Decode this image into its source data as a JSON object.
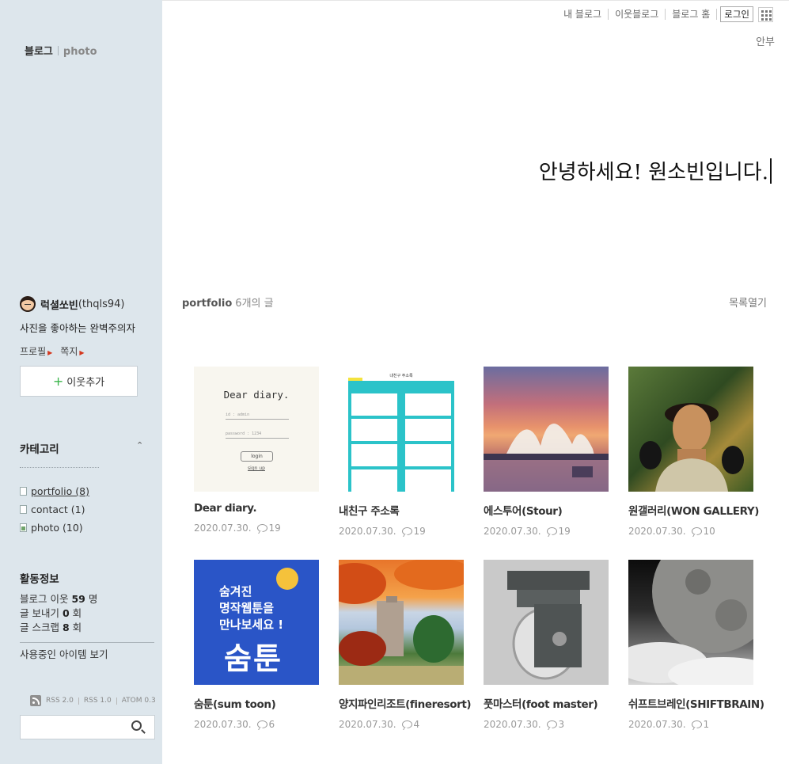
{
  "header": {
    "nav": [
      "내 블로그",
      "이웃블로그",
      "블로그 홈"
    ],
    "login": "로그인",
    "sub_nav": "안부"
  },
  "sidebar": {
    "brand": "블로그",
    "brand_category": "photo",
    "profile": {
      "nickname": "럭셜쏘빈",
      "user_id": "(thqls94)",
      "description": "사진을 좋아하는 완벽주의자",
      "links": [
        "프로필",
        "쪽지"
      ],
      "add_neighbor": "이웃추가"
    },
    "category": {
      "title": "카테고리",
      "items": [
        {
          "label": "portfolio (8)",
          "icon": "doc-icon",
          "active": true
        },
        {
          "label": "contact (1)",
          "icon": "doc-icon",
          "active": false
        },
        {
          "label": "photo (10)",
          "icon": "image-icon",
          "active": false
        }
      ]
    },
    "activity": {
      "title": "활동정보",
      "rows": [
        {
          "pre": "블로그 이웃 ",
          "num": "59",
          "post": " 명"
        },
        {
          "pre": "글 보내기 ",
          "num": "0",
          "post": " 회"
        },
        {
          "pre": "글 스크랩 ",
          "num": "8",
          "post": " 회"
        }
      ],
      "items_link": "사용중인 아이템 보기"
    },
    "feeds": [
      "RSS 2.0",
      "RSS 1.0",
      "ATOM 0.3"
    ],
    "search": {
      "placeholder": ""
    }
  },
  "main": {
    "greeting": "안녕하세요! 원소빈입니다.",
    "list_category": "portfolio",
    "list_count": "6개의 글",
    "list_open": "목록열기",
    "posts": [
      {
        "title": "Dear diary.",
        "date": "2020.07.30.",
        "comments": "19",
        "thumb": "t-diary"
      },
      {
        "title": "내친구 주소록",
        "date": "2020.07.30.",
        "comments": "19",
        "thumb": "t-addr"
      },
      {
        "title": "에스투어(Stour)",
        "date": "2020.07.30.",
        "comments": "19",
        "thumb": "t-opera"
      },
      {
        "title": "원갤러리(WON GALLERY)",
        "date": "2020.07.30.",
        "comments": "10",
        "thumb": "t-frida"
      },
      {
        "title": "숨툰(sum toon)",
        "date": "2020.07.30.",
        "comments": "6",
        "thumb": "t-sum"
      },
      {
        "title": "양지파인리조트(fineresort)",
        "date": "2020.07.30.",
        "comments": "4",
        "thumb": "t-resort"
      },
      {
        "title": "풋마스터(foot master)",
        "date": "2020.07.30.",
        "comments": "3",
        "thumb": "t-caster"
      },
      {
        "title": "쉬프트브레인(SHIFTBRAIN)",
        "date": "2020.07.30.",
        "comments": "1",
        "thumb": "t-moon"
      }
    ],
    "thumb_text": {
      "diary": {
        "heading": "Dear diary.",
        "id_field": "id : admin",
        "pw_field": "password : 1234",
        "login_btn": "login",
        "signup": "sign up"
      },
      "addr": {
        "heading": "내친구 주소록"
      },
      "sum": {
        "line1": "숨겨진",
        "line2": "명작웹툰을",
        "line3": "만나보세요 !",
        "big": "숨툰"
      }
    }
  }
}
